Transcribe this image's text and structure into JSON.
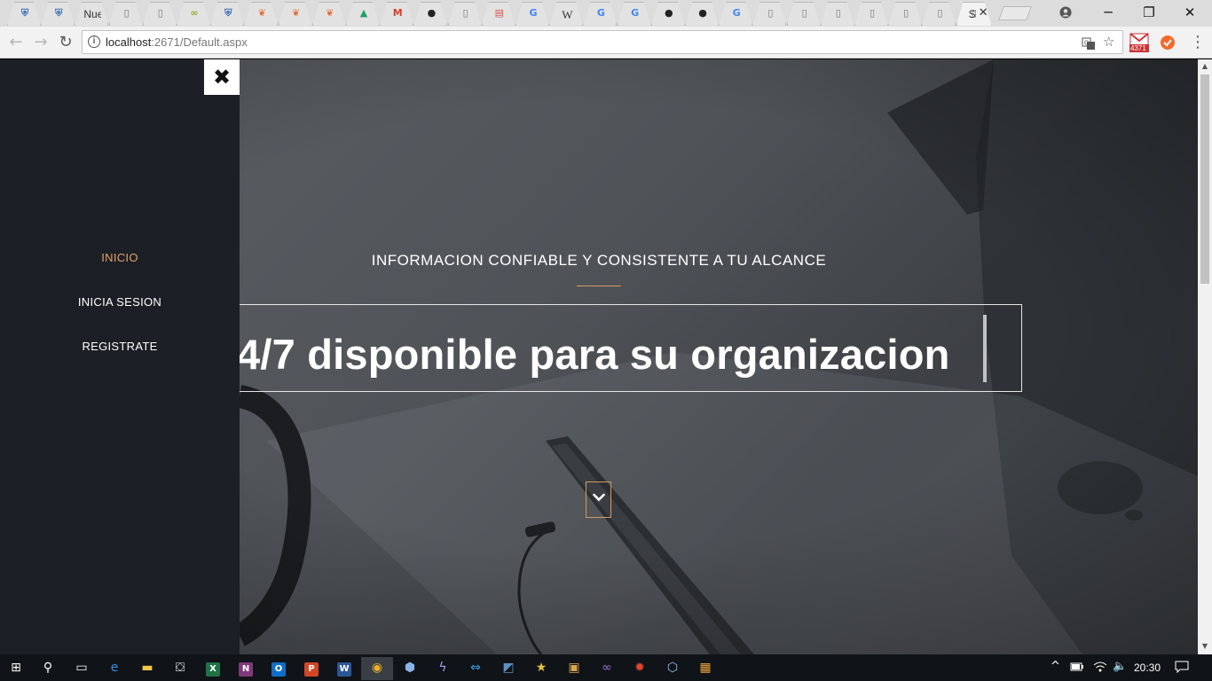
{
  "browser": {
    "tabs": [
      {
        "icon": "shield-icon",
        "label": ""
      },
      {
        "icon": "shield-icon",
        "label": ""
      },
      {
        "icon": "text-icon",
        "label": "Nue"
      },
      {
        "icon": "page-icon",
        "label": ""
      },
      {
        "icon": "page-icon",
        "label": ""
      },
      {
        "icon": "chain-icon",
        "label": ""
      },
      {
        "icon": "shield-icon",
        "label": ""
      },
      {
        "icon": "fox-icon",
        "label": ""
      },
      {
        "icon": "fox-icon",
        "label": ""
      },
      {
        "icon": "fox-icon",
        "label": ""
      },
      {
        "icon": "drive-icon",
        "label": ""
      },
      {
        "icon": "gmail-icon",
        "label": ""
      },
      {
        "icon": "github-icon",
        "label": ""
      },
      {
        "icon": "page-icon",
        "label": ""
      },
      {
        "icon": "pdf-icon",
        "label": ""
      },
      {
        "icon": "google-icon",
        "label": ""
      },
      {
        "icon": "wikipedia-icon",
        "label": "W"
      },
      {
        "icon": "google-icon",
        "label": ""
      },
      {
        "icon": "google-icon",
        "label": ""
      },
      {
        "icon": "github-icon",
        "label": ""
      },
      {
        "icon": "github-icon",
        "label": ""
      },
      {
        "icon": "google-icon",
        "label": ""
      },
      {
        "icon": "page-icon",
        "label": ""
      },
      {
        "icon": "page-icon",
        "label": ""
      },
      {
        "icon": "page-icon",
        "label": ""
      },
      {
        "icon": "page-icon",
        "label": ""
      },
      {
        "icon": "page-icon",
        "label": ""
      },
      {
        "icon": "page-icon",
        "label": ""
      },
      {
        "icon": "page-icon",
        "label": "S",
        "active": true
      }
    ],
    "url_host": "localhost",
    "url_rest": ":2671/Default.aspx",
    "gmail_badge": "4371"
  },
  "page": {
    "close_symbol": "✖",
    "nav": [
      {
        "label": "INICIO",
        "active": true
      },
      {
        "label": "INICIA SESION",
        "active": false
      },
      {
        "label": "REGISTRATE",
        "active": false
      }
    ],
    "tagline": "INFORMACION CONFIABLE Y CONSISTENTE A TU ALCANCE",
    "headline": "4/7 disponible para su organizacion",
    "accent_color": "#d79a5f"
  },
  "taskbar": {
    "apps": [
      {
        "name": "start-icon"
      },
      {
        "name": "search-icon"
      },
      {
        "name": "task-view-icon"
      },
      {
        "name": "edge-icon"
      },
      {
        "name": "file-explorer-icon"
      },
      {
        "name": "store-icon"
      },
      {
        "name": "excel-icon",
        "letter": "X"
      },
      {
        "name": "onenote-icon",
        "letter": "N"
      },
      {
        "name": "outlook-icon",
        "letter": "O"
      },
      {
        "name": "powerpoint-icon",
        "letter": "P"
      },
      {
        "name": "word-icon",
        "letter": "W"
      },
      {
        "name": "chrome-icon"
      },
      {
        "name": "virtualbox-icon"
      },
      {
        "name": "app-icon"
      },
      {
        "name": "teamviewer-icon"
      },
      {
        "name": "sql-icon"
      },
      {
        "name": "star-app-icon"
      },
      {
        "name": "media-icon"
      },
      {
        "name": "visual-studio-icon"
      },
      {
        "name": "settings-gear-icon"
      },
      {
        "name": "cube-icon"
      },
      {
        "name": "tiles-icon"
      }
    ],
    "clock": "20:30"
  }
}
